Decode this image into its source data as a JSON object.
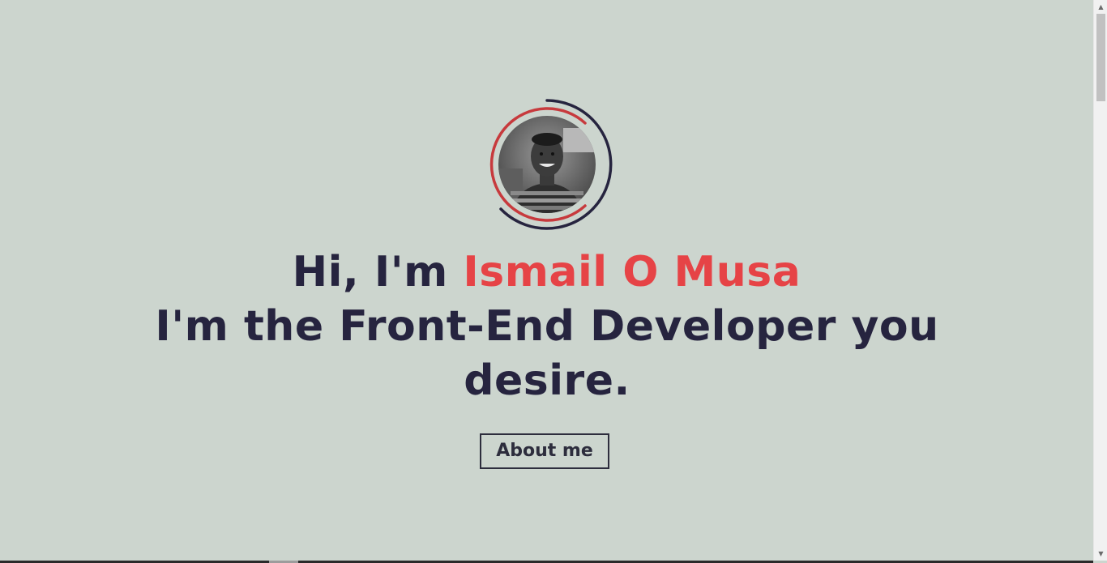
{
  "hero": {
    "greeting": "Hi, I'm ",
    "name": "Ismail O Musa",
    "tagline": "I'm the Front-End Developer you desire.",
    "button_label": "About me"
  },
  "colors": {
    "background": "#ccd5ce",
    "headline": "#26243f",
    "accent": "#e64346",
    "ring_outer": "#26243f",
    "ring_inner": "#c73a3d"
  },
  "avatar": {
    "icon": "profile-photo"
  },
  "scrollbar": {
    "up_icon": "triangle-up-icon",
    "down_icon": "triangle-down-icon"
  }
}
